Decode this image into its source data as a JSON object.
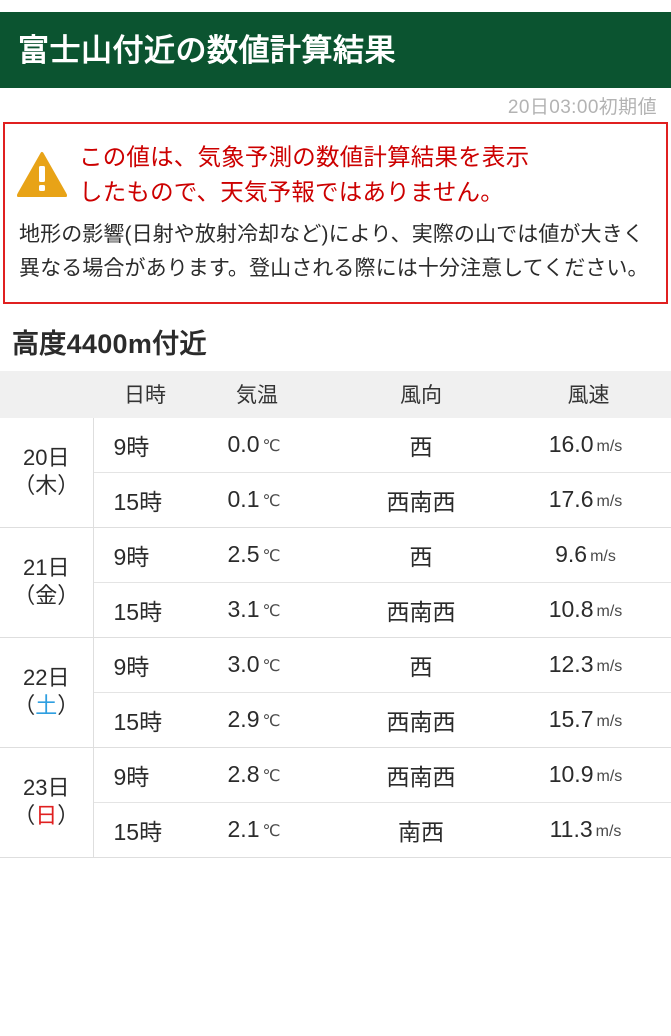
{
  "header": {
    "title": "富士山付近の数値計算結果",
    "init_time": "20日03:00初期値",
    "bar_color": "#0b5430",
    "title_color": "#ffffff",
    "init_time_color": "#b3b3b3"
  },
  "warning": {
    "icon": "warning-triangle-icon",
    "icon_color": "#e8a317",
    "border_color": "#e02020",
    "lead_color": "#cc0000",
    "lead_text": "この値は、気象予測の数値計算結果を表示したものです。",
    "lead_line1": "この値は、気象予測の数値計算結果を表示",
    "lead_line2": "したもので、天気予報ではありません。",
    "body_text": "地形の影響(日射や放射冷却など)により、実際の山では値が大きく異なる場合があります。登山される際には十分注意してください。"
  },
  "section": {
    "title": "高度4400m付近"
  },
  "table": {
    "headers": {
      "datetime": "日時",
      "temperature": "気温",
      "wind_direction": "風向",
      "wind_speed": "風速"
    },
    "units": {
      "temperature": "℃",
      "wind_speed": "m/s"
    },
    "groups": [
      {
        "date": "20日",
        "dow": "木",
        "dow_type": "normal",
        "rows": [
          {
            "time": "9時",
            "temp": "0.0",
            "dir": "西",
            "wind": "16.0"
          },
          {
            "time": "15時",
            "temp": "0.1",
            "dir": "西南西",
            "wind": "17.6"
          }
        ]
      },
      {
        "date": "21日",
        "dow": "金",
        "dow_type": "normal",
        "rows": [
          {
            "time": "9時",
            "temp": "2.5",
            "dir": "西",
            "wind": "9.6"
          },
          {
            "time": "15時",
            "temp": "3.1",
            "dir": "西南西",
            "wind": "10.8"
          }
        ]
      },
      {
        "date": "22日",
        "dow": "土",
        "dow_type": "sat",
        "rows": [
          {
            "time": "9時",
            "temp": "3.0",
            "dir": "西",
            "wind": "12.3"
          },
          {
            "time": "15時",
            "temp": "2.9",
            "dir": "西南西",
            "wind": "15.7"
          }
        ]
      },
      {
        "date": "23日",
        "dow": "日",
        "dow_type": "sun",
        "rows": [
          {
            "time": "9時",
            "temp": "2.8",
            "dir": "西南西",
            "wind": "10.9"
          },
          {
            "time": "15時",
            "temp": "2.1",
            "dir": "南西",
            "wind": "11.3"
          }
        ]
      }
    ]
  }
}
